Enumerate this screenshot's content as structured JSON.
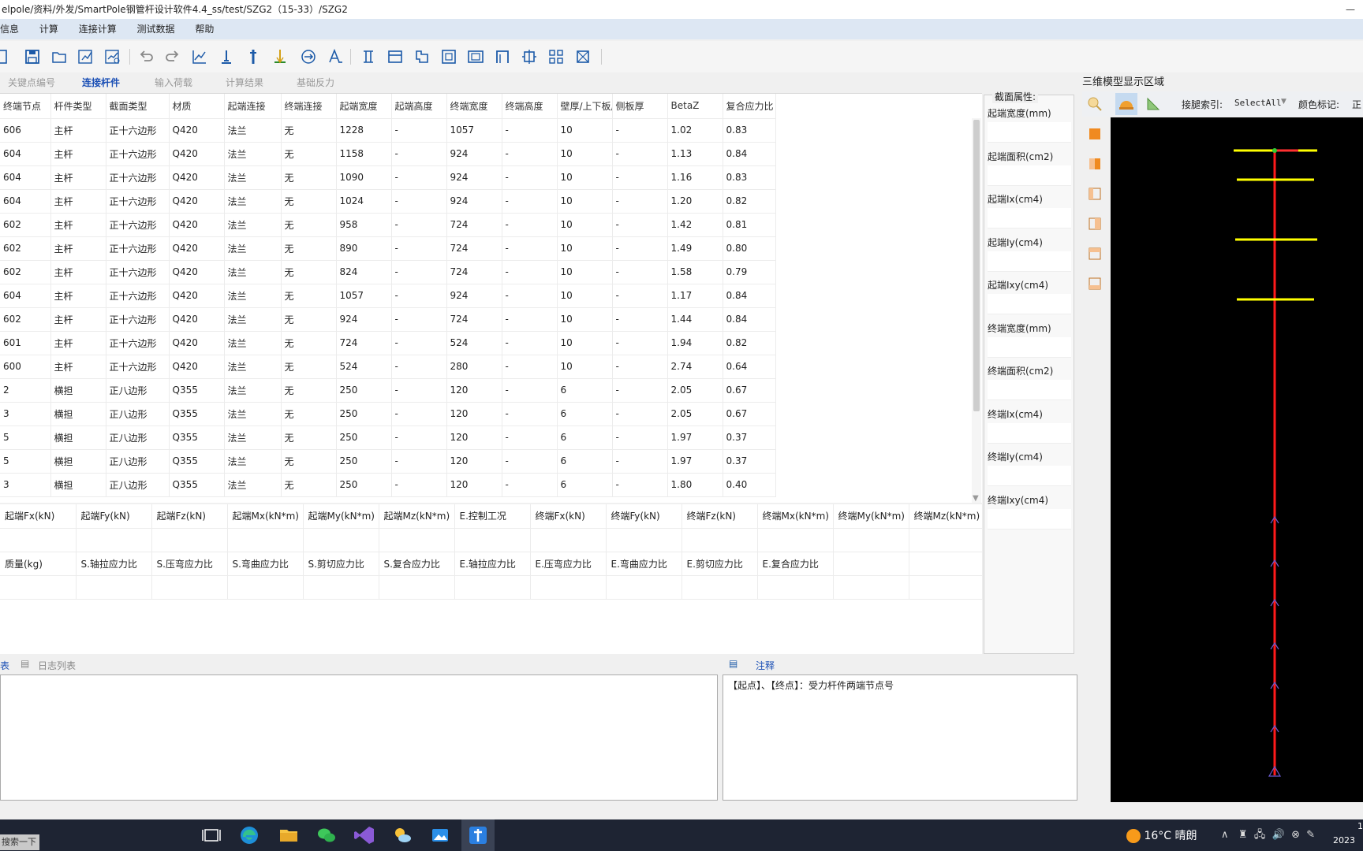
{
  "window": {
    "title": "elpole/资料/外发/SmartPole钢管杆设计软件4.4_ss/test/SZG2（15-33）/SZG2",
    "minimize": "—"
  },
  "menu": [
    "信息",
    "计算",
    "连接计算",
    "测试数据",
    "帮助"
  ],
  "toolbar_icons": [
    "save-icon",
    "save-as-icon",
    "open-folder-icon",
    "edit-chart-icon",
    "calc-chart-icon",
    "undo-icon",
    "redo-icon",
    "line-chart-icon",
    "pole-base-icon",
    "pole-icon",
    "load-icon",
    "circle-arrow-icon",
    "text-icon",
    "flange-icon",
    "section-icon",
    "bracket-icon",
    "frame-icon",
    "frame2-icon",
    "arch-icon",
    "joint-icon",
    "grid-icon",
    "joint2-icon"
  ],
  "tabs": [
    "关键点编号",
    "连接杆件",
    "输入荷载",
    "计算结果",
    "基础反力"
  ],
  "active_tab": "连接杆件",
  "grid": {
    "headers": [
      "终端节点",
      "杆件类型",
      "截面类型",
      "材质",
      "起端连接",
      "终端连接",
      "起端宽度",
      "起端高度",
      "终端宽度",
      "终端高度",
      "壁厚/上下板厚",
      "侧板厚",
      "BetaZ",
      "复合应力比"
    ],
    "rows": [
      [
        "606",
        "主杆",
        "正十六边形",
        "Q420",
        "法兰",
        "无",
        "1228",
        "-",
        "1057",
        "-",
        "10",
        "-",
        "1.02",
        "0.83"
      ],
      [
        "604",
        "主杆",
        "正十六边形",
        "Q420",
        "法兰",
        "无",
        "1158",
        "-",
        "924",
        "-",
        "10",
        "-",
        "1.13",
        "0.84"
      ],
      [
        "604",
        "主杆",
        "正十六边形",
        "Q420",
        "法兰",
        "无",
        "1090",
        "-",
        "924",
        "-",
        "10",
        "-",
        "1.16",
        "0.83"
      ],
      [
        "604",
        "主杆",
        "正十六边形",
        "Q420",
        "法兰",
        "无",
        "1024",
        "-",
        "924",
        "-",
        "10",
        "-",
        "1.20",
        "0.82"
      ],
      [
        "602",
        "主杆",
        "正十六边形",
        "Q420",
        "法兰",
        "无",
        "958",
        "-",
        "724",
        "-",
        "10",
        "-",
        "1.42",
        "0.81"
      ],
      [
        "602",
        "主杆",
        "正十六边形",
        "Q420",
        "法兰",
        "无",
        "890",
        "-",
        "724",
        "-",
        "10",
        "-",
        "1.49",
        "0.80"
      ],
      [
        "602",
        "主杆",
        "正十六边形",
        "Q420",
        "法兰",
        "无",
        "824",
        "-",
        "724",
        "-",
        "10",
        "-",
        "1.58",
        "0.79"
      ],
      [
        "604",
        "主杆",
        "正十六边形",
        "Q420",
        "法兰",
        "无",
        "1057",
        "-",
        "924",
        "-",
        "10",
        "-",
        "1.17",
        "0.84"
      ],
      [
        "602",
        "主杆",
        "正十六边形",
        "Q420",
        "法兰",
        "无",
        "924",
        "-",
        "724",
        "-",
        "10",
        "-",
        "1.44",
        "0.84"
      ],
      [
        "601",
        "主杆",
        "正十六边形",
        "Q420",
        "法兰",
        "无",
        "724",
        "-",
        "524",
        "-",
        "10",
        "-",
        "1.94",
        "0.82"
      ],
      [
        "600",
        "主杆",
        "正十六边形",
        "Q420",
        "法兰",
        "无",
        "524",
        "-",
        "280",
        "-",
        "10",
        "-",
        "2.74",
        "0.64"
      ],
      [
        "2",
        "横担",
        "正八边形",
        "Q355",
        "法兰",
        "无",
        "250",
        "-",
        "120",
        "-",
        "6",
        "-",
        "2.05",
        "0.67"
      ],
      [
        "3",
        "横担",
        "正八边形",
        "Q355",
        "法兰",
        "无",
        "250",
        "-",
        "120",
        "-",
        "6",
        "-",
        "2.05",
        "0.67"
      ],
      [
        "5",
        "横担",
        "正八边形",
        "Q355",
        "法兰",
        "无",
        "250",
        "-",
        "120",
        "-",
        "6",
        "-",
        "1.97",
        "0.37"
      ],
      [
        "5",
        "横担",
        "正八边形",
        "Q355",
        "法兰",
        "无",
        "250",
        "-",
        "120",
        "-",
        "6",
        "-",
        "1.97",
        "0.37"
      ],
      [
        "3",
        "横担",
        "正八边形",
        "Q355",
        "法兰",
        "无",
        "250",
        "-",
        "120",
        "-",
        "6",
        "-",
        "1.80",
        "0.40"
      ]
    ]
  },
  "forces_headers": [
    "起端Fx(kN)",
    "起端Fy(kN)",
    "起端Fz(kN)",
    "起端Mx(kN*m)",
    "起端My(kN*m)",
    "起端Mz(kN*m)",
    "E.控制工况",
    "终端Fx(kN)",
    "终端Fy(kN)",
    "终端Fz(kN)",
    "终端Mx(kN*m)",
    "终端My(kN*m)",
    "终端Mz(kN*m)"
  ],
  "ratio_headers": [
    "质量(kg)",
    "S.轴拉应力比",
    "S.压弯应力比",
    "S.弯曲应力比",
    "S.剪切应力比",
    "S.复合应力比",
    "E.轴拉应力比",
    "E.压弯应力比",
    "E.弯曲应力比",
    "E.剪切应力比",
    "E.复合应力比",
    "",
    ""
  ],
  "section_panel": {
    "title": "截面属性:",
    "items": [
      "起端宽度(mm)",
      "起端面积(cm2)",
      "起端Ix(cm4)",
      "起端Iy(cm4)",
      "起端Ixy(cm4)",
      "终端宽度(mm)",
      "终端面积(cm2)",
      "终端Ix(cm4)",
      "终端Iy(cm4)",
      "终端Ixy(cm4)"
    ]
  },
  "log": {
    "tab1": "表",
    "tab2": "日志列表"
  },
  "note": {
    "tab": "注释",
    "text": "【起点】、【终点】：受力杆件两端节点号"
  },
  "view3d": {
    "title": "三维模型显示区域",
    "index_label": "接腿索引:",
    "index_value": "SelectAll",
    "color_label": "颜色标记:",
    "color_value": "正"
  },
  "taskbar": {
    "search": "搜索一下",
    "weather": "16°C 晴朗",
    "date": "2023",
    "time": "1"
  },
  "colors": {
    "active_tab": "#1a4fb5",
    "menubar": "#dde7f3",
    "pole": "#ff0000",
    "crossarm": "#ffff00",
    "view_bg": "#000000"
  }
}
